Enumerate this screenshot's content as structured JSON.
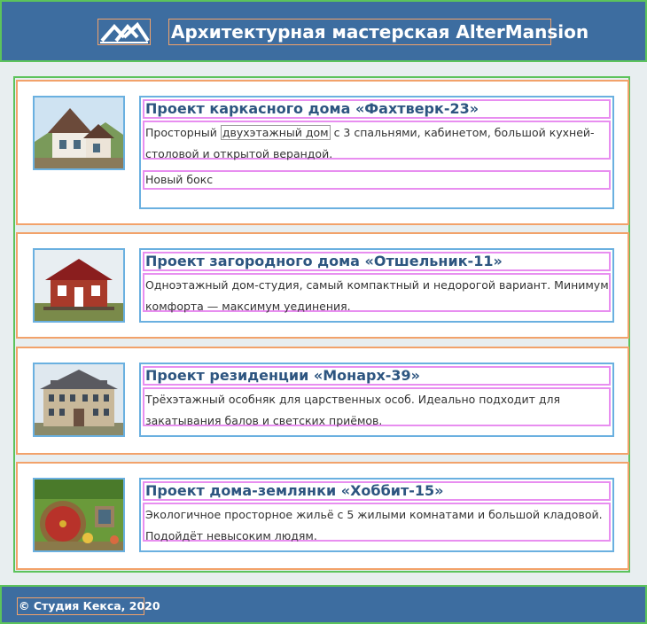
{
  "header": {
    "title": "Архитектурная мастерская AlterMansion",
    "logo_icon": "mountains-logo-icon"
  },
  "projects": [
    {
      "title": "Проект каркасного дома «Фахтверк-23»",
      "desc_before": "Просторный ",
      "desc_highlight": "двухэтажный дом",
      "desc_after": " с 3 спальнями, кабинетом, большой кухней-столовой и открытой верандой.",
      "extra": "Новый бокс",
      "image_icon": "frame-house-photo"
    },
    {
      "title": "Проект загородного дома «Отшельник-11»",
      "desc": "Одноэтажный дом-студия, самый компактный и недорогой вариант. Минимум комфорта — максимум уединения.",
      "image_icon": "red-cottage-photo"
    },
    {
      "title": "Проект резиденции «Монарх-39»",
      "desc": "Трёхэтажный особняк для царственных особ. Идеально подходит для закатывания балов и светских приёмов.",
      "image_icon": "mansion-photo"
    },
    {
      "title": "Проект дома-землянки «Хоббит-15»",
      "desc": "Экологичное просторное жильё с 5 жилыми комнатами и большой кладовой. Подойдёт невысоким людям.",
      "image_icon": "hobbit-house-photo"
    }
  ],
  "footer": {
    "copyright": "© Студия Кекса, 2020"
  }
}
